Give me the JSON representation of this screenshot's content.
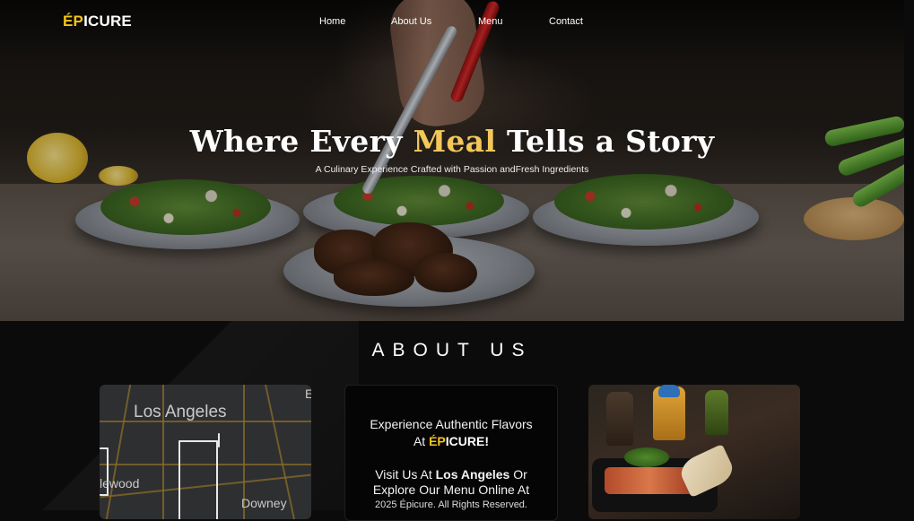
{
  "nav": {
    "brand_accent": "ÉP",
    "brand_rest": "ICURE",
    "links": [
      "Home",
      "About Us",
      "Menu",
      "Contact"
    ]
  },
  "hero": {
    "title_before": "Where Every ",
    "title_accent": "Meal",
    "title_after": " Tells a Story",
    "subtitle": "A Culinary Experience Crafted with Passion andFresh Ingredients"
  },
  "about": {
    "heading": "ABOUT US",
    "map_labels": [
      "Los Angeles",
      "lewood",
      "Downey",
      "E"
    ],
    "info": {
      "line1": "Experience Authentic Flavors",
      "line2_prefix": "At ",
      "brand_accent": "ÉP",
      "brand_rest": "ICURE!",
      "line3_prefix": "Visit Us At ",
      "line3_bold": "Los Angeles",
      "line3_suffix": " Or",
      "line4": "Explore Our Menu Online At",
      "copyright": "2025 Épicure. All Rights Reserved."
    }
  },
  "colors": {
    "accent_yellow": "#f5c518",
    "title_accent": "#f3c75a",
    "background": "#0b0b0b"
  }
}
